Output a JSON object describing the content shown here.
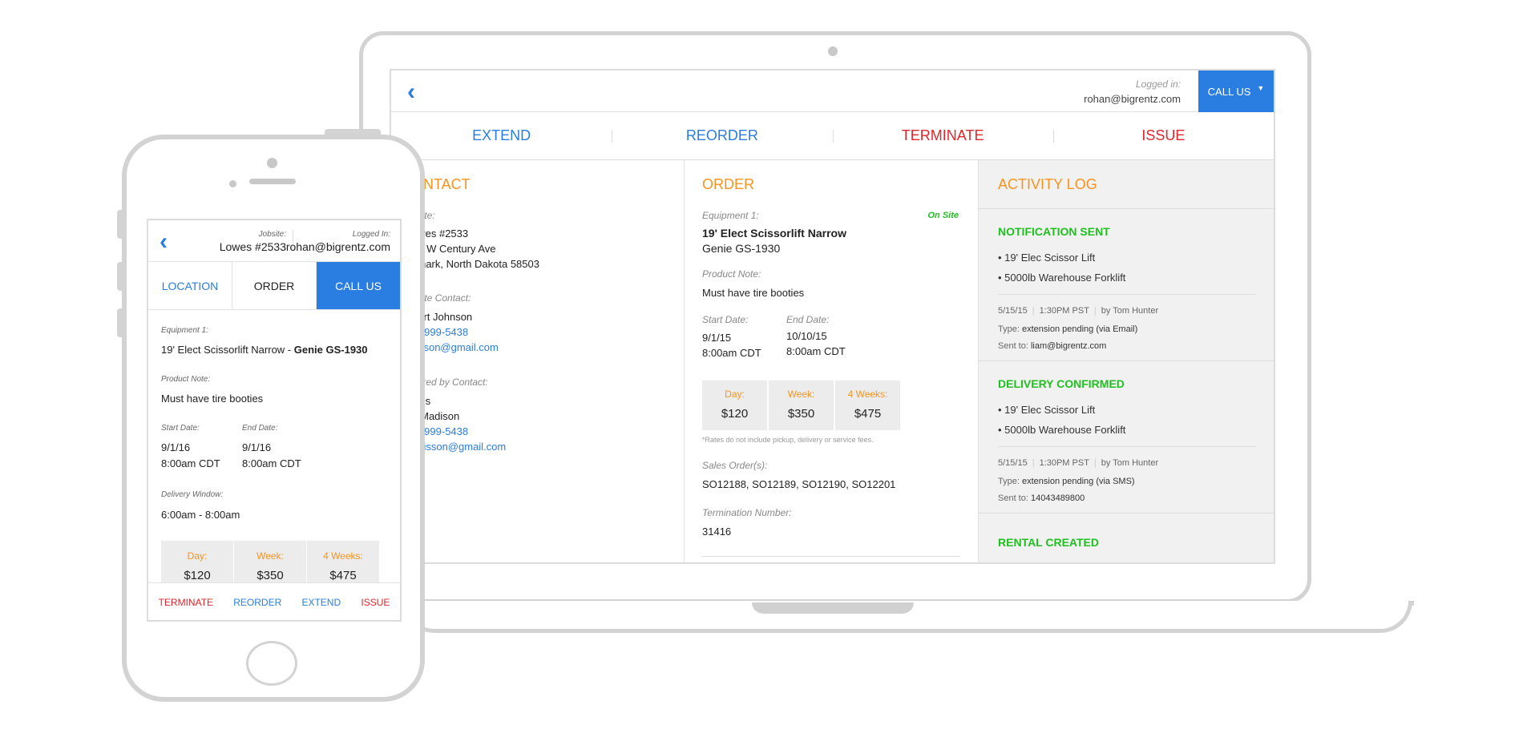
{
  "laptop": {
    "logged_label": "Logged in:",
    "logged_user": "rohan@bigrentz.com",
    "call_us": "CALL US",
    "actions": [
      "EXTEND",
      "REORDER",
      "TERMINATE",
      "ISSUE"
    ],
    "contact": {
      "title": "ONTACT",
      "jobsite_label": "bsite:",
      "jobsite_lines": [
        "owes #2533",
        "01 W Century Ave",
        "smark, North Dakota 58503"
      ],
      "jobsite_contact_label": "bsite Contact:",
      "jobsite_contact_name": "bert Johnson",
      "jobsite_contact_phone": "5) 999-5438",
      "jobsite_contact_email": "hnson@gmail.com",
      "ordered_label": "dered by Contact:",
      "ordered_company": "wes",
      "ordered_name": "y Madison",
      "ordered_phone": "5) 999-5438",
      "ordered_email": "adisson@gmail.com"
    },
    "order": {
      "title": "ORDER",
      "equipment_label": "Equipment 1:",
      "status": "On Site",
      "equipment_name": "19' Elect Scissorlift Narrow",
      "equipment_model": "Genie GS-1930",
      "product_note_label": "Product Note:",
      "product_note": "Must have tire booties",
      "start_label": "Start Date:",
      "start_date": "9/1/15",
      "start_time": "8:00am CDT",
      "end_label": "End Date:",
      "end_date": "10/10/15",
      "end_time": "8:00am CDT",
      "rates": [
        {
          "label": "Day:",
          "value": "$120"
        },
        {
          "label": "Week:",
          "value": "$350"
        },
        {
          "label": "4 Weeks:",
          "value": "$475"
        }
      ],
      "rates_note": "*Rates do not include pickup, delivery or service fees.",
      "sales_label": "Sales Order(s):",
      "sales_orders": "SO12188, SO12189, SO12190, SO12201",
      "termination_label": "Termination Number:",
      "termination_number": "31416"
    },
    "activity": {
      "title": "ACTIVITY LOG",
      "entries": [
        {
          "title": "NOTIFICATION SENT",
          "items": [
            "• 19' Elec Scissor Lift",
            "• 5000lb Warehouse Forklift"
          ],
          "date": "5/15/15",
          "time": "1:30PM PST",
          "by": "by Tom Hunter",
          "type_label": "Type:",
          "type": "extension pending (via Email)",
          "sent_label": "Sent to:",
          "sent": "liam@bigrentz.com"
        },
        {
          "title": "DELIVERY CONFIRMED",
          "items": [
            "• 19' Elec Scissor Lift",
            "• 5000lb Warehouse Forklift"
          ],
          "date": "5/15/15",
          "time": "1:30PM PST",
          "by": "by Tom Hunter",
          "type_label": "Type:",
          "type": "extension pending (via SMS)",
          "sent_label": "Sent to:",
          "sent": "14043489800"
        },
        {
          "title": "RENTAL CREATED"
        }
      ]
    }
  },
  "phone": {
    "jobsite_label": "Jobsite:",
    "jobsite": "Lowes #2533",
    "logged_label": "Logged In:",
    "logged_user": "rohan@bigrentz.com",
    "tabs": [
      "LOCATION",
      "ORDER",
      "CALL US"
    ],
    "equipment_label": "Equipment 1:",
    "equipment_name": "19' Elect Scissorlift Narrow - ",
    "equipment_model": "Genie GS-1930",
    "product_note_label": "Product Note:",
    "product_note": "Must have tire booties",
    "start_label": "Start Date:",
    "start_date": "9/1/16",
    "start_time": "8:00am CDT",
    "end_label": "End Date:",
    "end_date": "9/1/16",
    "end_time": "8:00am CDT",
    "delivery_label": "Delivery Window:",
    "delivery_window": "6:00am - 8:00am",
    "rates": [
      {
        "label": "Day:",
        "value": "$120"
      },
      {
        "label": "Week:",
        "value": "$350"
      },
      {
        "label": "4 Weeks:",
        "value": "$475"
      }
    ],
    "bottom_actions": [
      "TERMINATE",
      "REORDER",
      "EXTEND",
      "ISSUE"
    ]
  },
  "colors": {
    "blue": "#2a7de1",
    "red": "#e3242b",
    "orange": "#f7931e",
    "green": "#20c020"
  }
}
